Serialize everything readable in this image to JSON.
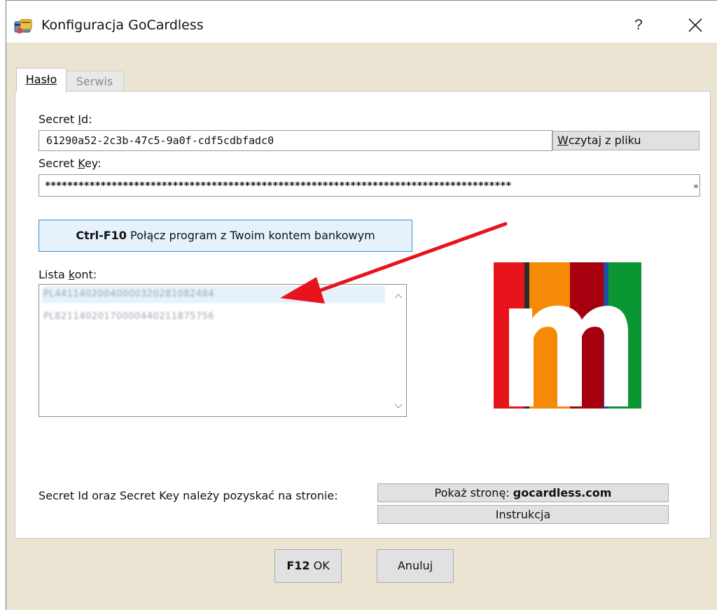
{
  "window": {
    "title": "Konfiguracja GoCardless",
    "help_label": "?"
  },
  "tabs": [
    {
      "label": "Hasło",
      "active": true
    },
    {
      "label": "Serwis",
      "active": false
    }
  ],
  "form": {
    "secret_id_label_pre": "Secret ",
    "secret_id_label_u": "I",
    "secret_id_label_post": "d:",
    "secret_id_value": "61290a52-2c3b-47c5-9a0f-cdf5cdbfadc0",
    "load_button_u": "W",
    "load_button_rest": "czytaj z pliku",
    "secret_key_label_pre": "Secret ",
    "secret_key_label_u": "K",
    "secret_key_label_post": "ey:",
    "secret_key_value": "************************************************************************************",
    "secret_key_overflow": "»"
  },
  "connect_button": {
    "shortcut": "Ctrl-F10",
    "label": "Połącz program z Twoim kontem bankowym"
  },
  "accounts": {
    "label_pre": "Lista ",
    "label_u": "k",
    "label_post": "ont:",
    "items": [
      {
        "value": "PL44114020040000320281082484",
        "selected": true
      },
      {
        "value": "PL82114020170000440211875756",
        "selected": false
      }
    ]
  },
  "info": {
    "text": "Secret Id oraz Secret Key należy pozyskać na stronie:",
    "show_page_pre": "Pokaż stronę: ",
    "show_page_domain": "gocardless.com",
    "instructions": "Instrukcja"
  },
  "footer": {
    "ok_shortcut": "F12",
    "ok_label": " OK",
    "cancel_label": "Anuluj"
  },
  "colors": {
    "accent_blue": "#3c8fd0",
    "arrow_red": "#e8141b",
    "logo_red": "#e8141b",
    "logo_orange": "#f58a07",
    "logo_darkred": "#a6000e",
    "logo_green": "#0b9634"
  },
  "icons": {
    "app": "credit-card-icon",
    "close": "close-icon",
    "scroll_up": "chevron-up-icon",
    "scroll_down": "chevron-down-icon"
  }
}
